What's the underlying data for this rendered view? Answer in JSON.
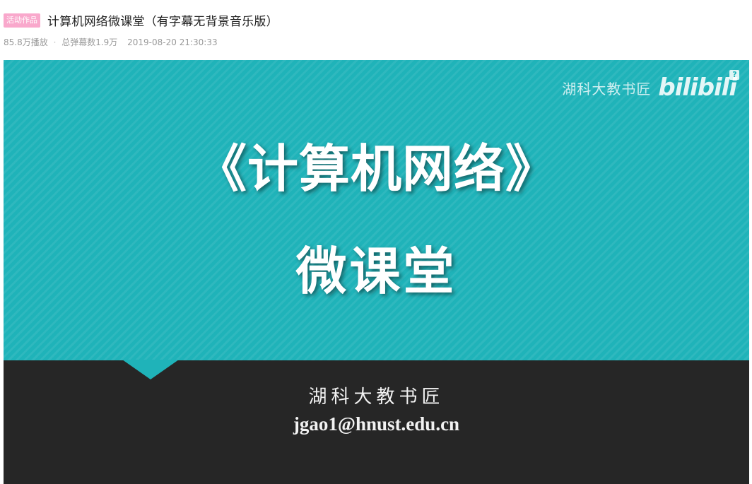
{
  "video": {
    "badge": "活动作品",
    "title": "计算机网络微课堂（有字幕无背景音乐版）",
    "plays": "85.8万播放",
    "separator": "·",
    "danmaku": "总弹幕数1.9万",
    "date": "2019-08-20 21:30:33"
  },
  "player": {
    "watermark_text": "湖科大教书匠",
    "watermark_logo": "bilibili",
    "watermark_badge": "?",
    "slide": {
      "title": "《计算机网络》",
      "subtitle": "微课堂",
      "author": "湖科大教书匠",
      "email": "jgao1@hnust.edu.cn"
    }
  },
  "colors": {
    "badge_bg": "#f9a8cc",
    "teal": "#1fb3b9",
    "dark": "#262626"
  }
}
